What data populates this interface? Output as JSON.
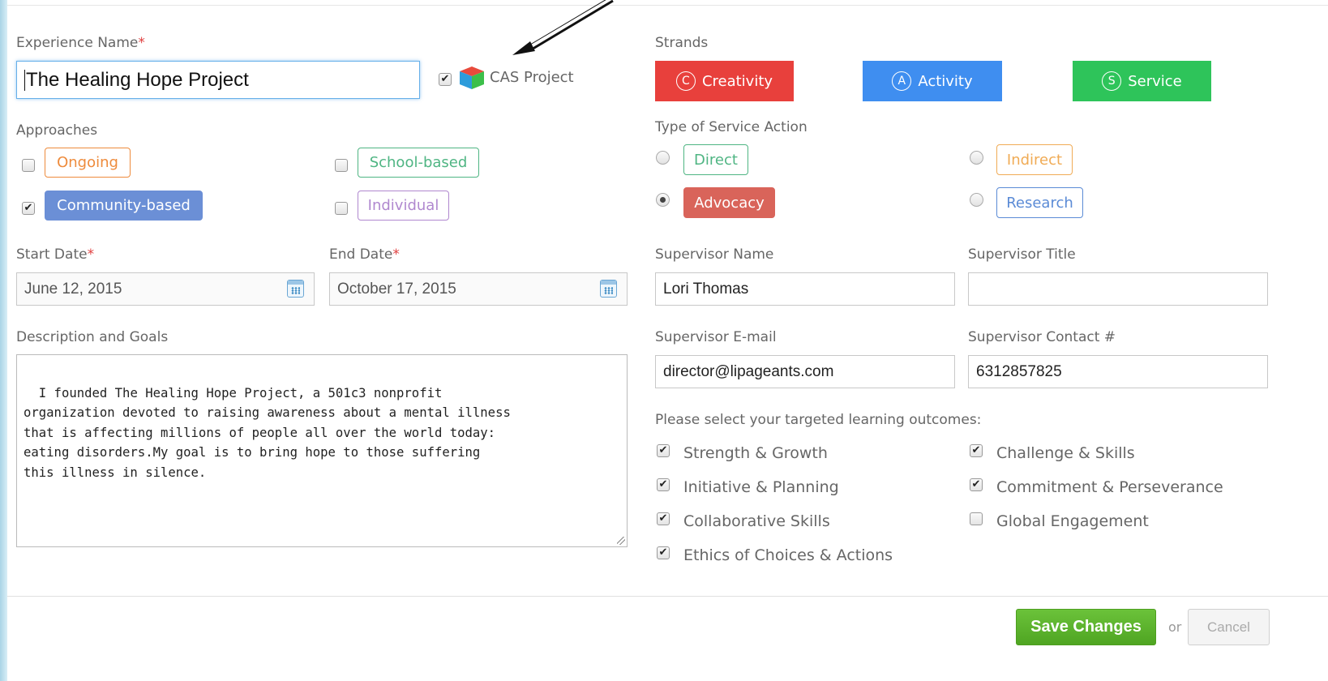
{
  "experience": {
    "label": "Experience Name",
    "required_mark": "*",
    "value": "The Healing Hope Project",
    "cas_label": "CAS Project",
    "cas_checked": true
  },
  "approaches": {
    "label": "Approaches",
    "items": [
      {
        "label": "Ongoing",
        "checked": false,
        "color": "#ee8b3c"
      },
      {
        "label": "School-based",
        "checked": false,
        "color": "#4fb583"
      },
      {
        "label": "Community-based",
        "checked": true,
        "color": "#6b8fd6"
      },
      {
        "label": "Individual",
        "checked": false,
        "color": "#b088cf"
      }
    ]
  },
  "dates": {
    "start_label": "Start Date",
    "start_value": "June 12, 2015",
    "end_label": "End Date",
    "end_value": "October 17, 2015",
    "required_mark": "*"
  },
  "description": {
    "label": "Description and Goals",
    "value": "I founded The Healing Hope Project, a 501c3 nonprofit\norganization devoted to raising awareness about a mental illness\nthat is affecting millions of people all over the world today:\neating disorders.My goal is to bring hope to those suffering\nthis illness in silence."
  },
  "strands": {
    "label": "Strands",
    "items": [
      {
        "letter": "C",
        "label": "Creativity",
        "color": "#e8403c"
      },
      {
        "letter": "A",
        "label": "Activity",
        "color": "#3f8ef0"
      },
      {
        "letter": "S",
        "label": "Service",
        "color": "#2ec45a"
      }
    ]
  },
  "service_action": {
    "label": "Type of Service Action",
    "options": [
      {
        "label": "Direct",
        "selected": false,
        "color": "#4fb583"
      },
      {
        "label": "Indirect",
        "selected": false,
        "color": "#f0ab55"
      },
      {
        "label": "Advocacy",
        "selected": true,
        "color": "#d9645a"
      },
      {
        "label": "Research",
        "selected": false,
        "color": "#5b8bd6"
      }
    ]
  },
  "supervisor": {
    "name_label": "Supervisor Name",
    "name_value": "Lori Thomas",
    "title_label": "Supervisor Title",
    "title_value": "",
    "email_label": "Supervisor E-mail",
    "email_value": "director@lipageants.com",
    "contact_label": "Supervisor Contact #",
    "contact_value": "6312857825"
  },
  "outcomes": {
    "label": "Please select your targeted learning outcomes:",
    "items": [
      {
        "label": "Strength & Growth",
        "checked": true
      },
      {
        "label": "Challenge & Skills",
        "checked": true
      },
      {
        "label": "Initiative & Planning",
        "checked": true
      },
      {
        "label": "Commitment & Perseverance",
        "checked": true
      },
      {
        "label": "Collaborative Skills",
        "checked": true
      },
      {
        "label": "Global Engagement",
        "checked": false
      },
      {
        "label": "Ethics of Choices & Actions",
        "checked": true
      }
    ]
  },
  "footer": {
    "save_label": "Save Changes",
    "or_label": "or",
    "cancel_label": "Cancel"
  },
  "icons": {
    "check": "✔",
    "cas_icon": "cube-icon",
    "calendar": "calendar-icon",
    "annotation": "arrow-icon"
  }
}
